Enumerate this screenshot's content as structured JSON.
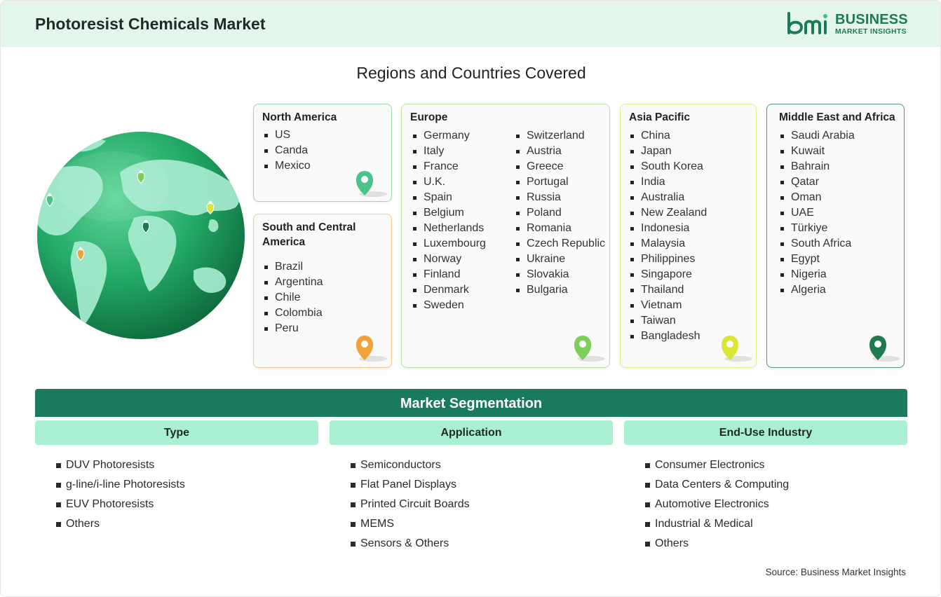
{
  "header": {
    "title": "Photoresist Chemicals Market",
    "logo_line1": "BUSINESS",
    "logo_line2": "MARKET INSIGHTS"
  },
  "regions_title": "Regions and Countries Covered",
  "regions": [
    {
      "name": "North America",
      "color": "#4cc38a",
      "countries": [
        "US",
        "Canda",
        "Mexico"
      ]
    },
    {
      "name": "South and Central America",
      "color": "#f2a23a",
      "countries": [
        "Brazil",
        "Argentina",
        "Chile",
        "Colombia",
        "Peru"
      ]
    },
    {
      "name": "Europe",
      "color": "#7ccf5a",
      "countries_col1": [
        "Germany",
        "Italy",
        "France",
        "U.K.",
        "Spain",
        "Belgium",
        "Netherlands",
        "Luxembourg",
        "Norway",
        "Finland",
        "Denmark",
        "Sweden"
      ],
      "countries_col2": [
        "Switzerland",
        "Austria",
        "Greece",
        "Portugal",
        "Russia",
        "Poland",
        "Romania",
        "Czech Republic",
        "Ukraine",
        "Slovakia",
        "Bulgaria"
      ]
    },
    {
      "name": "Asia Pacific",
      "color": "#dbe536",
      "countries": [
        "China",
        "Japan",
        "South Korea",
        "India",
        "Australia",
        "New Zealand",
        "Indonesia",
        "Malaysia",
        "Philippines",
        "Singapore",
        "Thailand",
        "Vietnam",
        "Taiwan",
        "Bangladesh"
      ]
    },
    {
      "name": "Middle East and Africa",
      "color": "#1f7a4f",
      "countries": [
        "Saudi Arabia",
        "Kuwait",
        "Bahrain",
        "Qatar",
        "Oman",
        "UAE",
        "Türkiye",
        "South Africa",
        "Egypt",
        "Nigeria",
        "Algeria"
      ]
    }
  ],
  "segmentation": {
    "title": "Market Segmentation",
    "columns": [
      {
        "heading": "Type",
        "items": [
          "DUV Photoresists",
          "g-line/i-line Photoresists",
          "EUV Photoresists",
          "Others"
        ]
      },
      {
        "heading": "Application",
        "items": [
          "Semiconductors",
          "Flat Panel Displays",
          "Printed Circuit Boards",
          "MEMS",
          "Sensors & Others"
        ]
      },
      {
        "heading": "End-Use Industry",
        "items": [
          "Consumer Electronics",
          "Data Centers & Computing",
          "Automotive Electronics",
          "Industrial & Medical",
          "Others"
        ]
      }
    ]
  },
  "source": "Source: Business Market Insights",
  "icons": [
    "globe-icon",
    "map-pin-icon",
    "bmi-logo-icon"
  ]
}
